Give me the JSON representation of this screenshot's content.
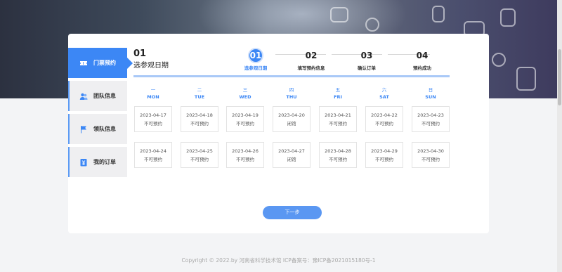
{
  "sidebar": {
    "items": [
      {
        "label": "门票预约",
        "icon": "ticket-icon",
        "active": true
      },
      {
        "label": "团队信息",
        "icon": "team-icon",
        "active": false
      },
      {
        "label": "领队信息",
        "icon": "flag-icon",
        "active": false
      },
      {
        "label": "我的订单",
        "icon": "order-icon",
        "active": false
      }
    ]
  },
  "current_step": {
    "number": "01",
    "title": "选参观日期"
  },
  "steps": [
    {
      "number": "01",
      "label": "选参观日期",
      "active": true
    },
    {
      "number": "02",
      "label": "填写预约信息",
      "active": false
    },
    {
      "number": "03",
      "label": "确认订单",
      "active": false
    },
    {
      "number": "04",
      "label": "预约成功",
      "active": false
    }
  ],
  "weekdays": [
    {
      "zh": "一",
      "en": "MON"
    },
    {
      "zh": "二",
      "en": "TUE"
    },
    {
      "zh": "三",
      "en": "WED"
    },
    {
      "zh": "四",
      "en": "THU"
    },
    {
      "zh": "五",
      "en": "FRI"
    },
    {
      "zh": "六",
      "en": "SAT"
    },
    {
      "zh": "日",
      "en": "SUN"
    }
  ],
  "calendar": {
    "rows": [
      [
        {
          "date": "2023-04-17",
          "status": "不可预约"
        },
        {
          "date": "2023-04-18",
          "status": "不可预约"
        },
        {
          "date": "2023-04-19",
          "status": "不可预约"
        },
        {
          "date": "2023-04-20",
          "status": "闭馆"
        },
        {
          "date": "2023-04-21",
          "status": "不可预约"
        },
        {
          "date": "2023-04-22",
          "status": "不可预约"
        },
        {
          "date": "2023-04-23",
          "status": "不可预约"
        }
      ],
      [
        {
          "date": "2023-04-24",
          "status": "不可预约"
        },
        {
          "date": "2023-04-25",
          "status": "不可预约"
        },
        {
          "date": "2023-04-26",
          "status": "不可预约"
        },
        {
          "date": "2023-04-27",
          "status": "闭馆"
        },
        {
          "date": "2023-04-28",
          "status": "不可预约"
        },
        {
          "date": "2023-04-29",
          "status": "不可预约"
        },
        {
          "date": "2023-04-30",
          "status": "不可预约"
        }
      ]
    ]
  },
  "next_button": {
    "label": "下一步"
  },
  "footer": {
    "text": "Copyright © 2022.by 河南省科学技术馆 ICP备案号：豫ICP备2021015180号-1"
  },
  "colors": {
    "accent": "#3c87f5",
    "button": "#5a97f2",
    "progress": "#a9c9f7"
  }
}
